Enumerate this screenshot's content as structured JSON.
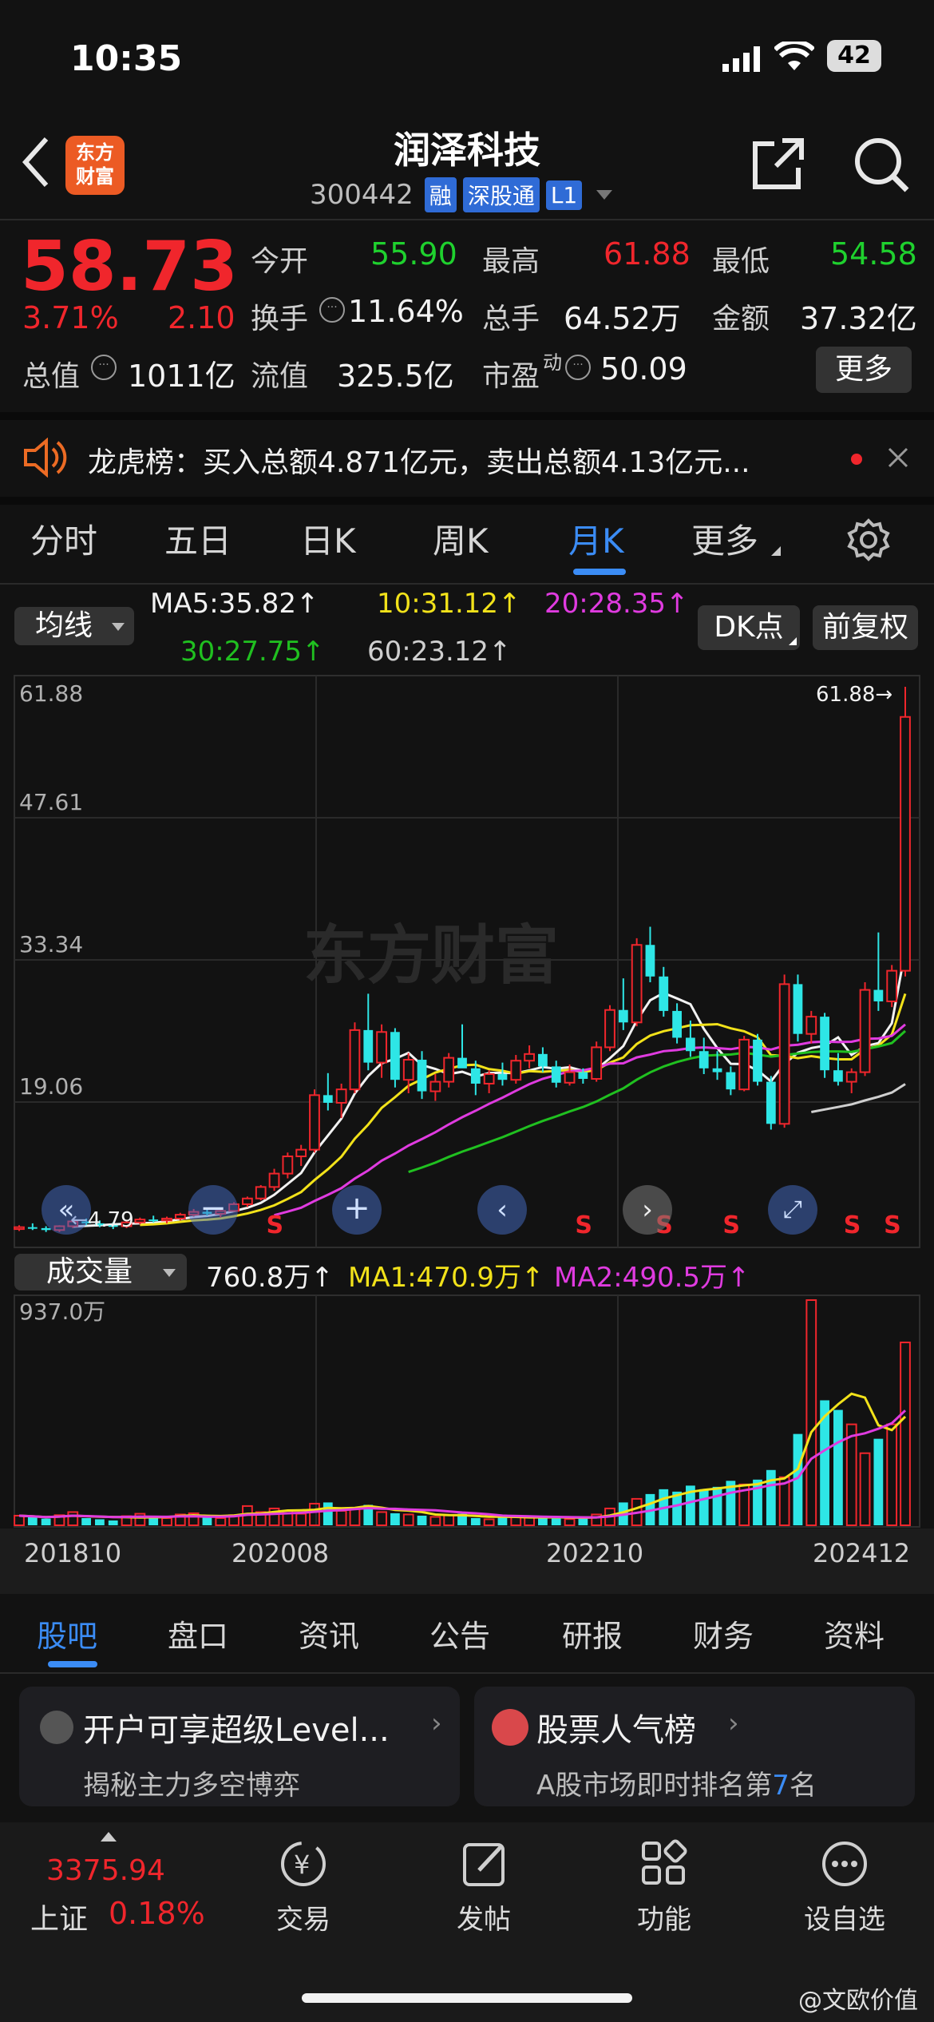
{
  "status": {
    "time": "10:35",
    "battery": "42"
  },
  "header": {
    "title": "润泽科技",
    "code": "300442",
    "badges": [
      "融",
      "深股通",
      "L1"
    ],
    "logo": "东方\n财富"
  },
  "quote": {
    "price": "58.73",
    "pct": "3.71%",
    "chg": "2.10",
    "fields": [
      {
        "label": "今开",
        "value": "55.90",
        "color": "#1fd12e"
      },
      {
        "label": "最高",
        "value": "61.88",
        "color": "#f0262c"
      },
      {
        "label": "最低",
        "value": "54.58",
        "color": "#1fd12e"
      },
      {
        "label": "换手",
        "value": "11.64%",
        "color": "#f2f2f2"
      },
      {
        "label": "总手",
        "value": "64.52万",
        "color": "#f2f2f2"
      },
      {
        "label": "金额",
        "value": "37.32亿",
        "color": "#f2f2f2"
      },
      {
        "label": "总值",
        "value": "1011亿",
        "color": "#f2f2f2"
      },
      {
        "label": "流值",
        "value": "325.5亿",
        "color": "#f2f2f2"
      },
      {
        "label": "市盈",
        "sup": "动",
        "value": "50.09",
        "color": "#f2f2f2"
      }
    ],
    "more": "更多"
  },
  "notice": {
    "text": "龙虎榜：买入总额4.871亿元，卖出总额4.13亿元..."
  },
  "period_tabs": [
    "分时",
    "五日",
    "日K",
    "周K",
    "月K",
    "更多"
  ],
  "active_period": "月K",
  "ma": {
    "selector": "均线",
    "ma5": "MA5:35.82",
    "ma10": "10:31.12",
    "ma20": "20:28.35",
    "ma30": "30:27.75",
    "ma60": "60:23.12",
    "dk": "DK点",
    "adjust": "前复权"
  },
  "chart_data": [
    {
      "type": "candlestick",
      "title": "月K",
      "y_ticks": [
        "61.88",
        "47.61",
        "33.34",
        "19.06"
      ],
      "ylim": [
        4.79,
        61.88
      ],
      "max_label": "61.88",
      "min_label": "4.79",
      "watermark": "东方财富",
      "x_ticks": [
        "201810",
        "202008",
        "202210",
        "202412"
      ],
      "candles": [
        [
          5.2,
          5.6,
          5.0,
          5.4
        ],
        [
          5.4,
          5.8,
          5.1,
          5.3
        ],
        [
          5.3,
          5.5,
          4.9,
          5.1
        ],
        [
          5.1,
          5.6,
          4.9,
          5.5
        ],
        [
          5.5,
          6.2,
          5.3,
          6.0
        ],
        [
          6.0,
          6.3,
          5.6,
          5.8
        ],
        [
          5.8,
          6.1,
          5.4,
          5.6
        ],
        [
          5.6,
          5.9,
          5.2,
          5.5
        ],
        [
          5.5,
          6.0,
          5.3,
          5.9
        ],
        [
          5.9,
          6.4,
          5.7,
          6.2
        ],
        [
          6.2,
          6.6,
          5.9,
          6.1
        ],
        [
          6.1,
          6.5,
          5.8,
          6.3
        ],
        [
          6.3,
          6.9,
          6.1,
          6.7
        ],
        [
          6.7,
          7.3,
          6.5,
          7.0
        ],
        [
          7.0,
          7.4,
          6.6,
          6.8
        ],
        [
          6.8,
          7.2,
          6.4,
          7.1
        ],
        [
          7.1,
          8.0,
          7.0,
          7.8
        ],
        [
          7.8,
          8.6,
          7.5,
          8.4
        ],
        [
          8.4,
          9.8,
          8.2,
          9.6
        ],
        [
          9.6,
          11.5,
          9.2,
          11.0
        ],
        [
          11.0,
          13.2,
          10.5,
          12.8
        ],
        [
          12.8,
          14.0,
          11.8,
          13.5
        ],
        [
          13.5,
          19.8,
          13.2,
          19.2
        ],
        [
          19.2,
          21.5,
          17.6,
          18.4
        ],
        [
          18.4,
          20.4,
          16.8,
          19.8
        ],
        [
          19.8,
          26.8,
          19.4,
          26.0
        ],
        [
          26.0,
          29.8,
          21.8,
          22.6
        ],
        [
          22.6,
          26.6,
          21.0,
          25.8
        ],
        [
          25.8,
          26.2,
          20.0,
          20.8
        ],
        [
          20.8,
          23.6,
          19.4,
          22.9
        ],
        [
          22.9,
          23.8,
          18.8,
          19.6
        ],
        [
          19.6,
          21.4,
          18.6,
          20.6
        ],
        [
          20.6,
          23.6,
          20.0,
          23.1
        ],
        [
          23.1,
          26.6,
          22.4,
          22.0
        ],
        [
          22.0,
          22.8,
          19.2,
          20.4
        ],
        [
          20.4,
          21.8,
          19.4,
          21.4
        ],
        [
          21.4,
          22.6,
          20.2,
          20.8
        ],
        [
          20.8,
          23.4,
          20.4,
          22.8
        ],
        [
          22.8,
          24.4,
          22.0,
          23.5
        ],
        [
          23.5,
          24.2,
          21.6,
          22.2
        ],
        [
          22.2,
          22.8,
          20.0,
          20.5
        ],
        [
          20.5,
          22.4,
          20.2,
          21.6
        ],
        [
          21.6,
          22.0,
          20.4,
          20.9
        ],
        [
          20.9,
          24.8,
          20.6,
          24.2
        ],
        [
          24.2,
          28.6,
          23.8,
          28.1
        ],
        [
          28.1,
          31.4,
          26.0,
          26.8
        ],
        [
          26.8,
          35.6,
          26.4,
          34.9
        ],
        [
          34.9,
          36.8,
          31.0,
          31.6
        ],
        [
          31.6,
          32.6,
          27.4,
          28.0
        ],
        [
          28.0,
          28.8,
          24.6,
          25.2
        ],
        [
          25.2,
          27.0,
          23.2,
          23.8
        ],
        [
          23.8,
          25.2,
          21.4,
          22.0
        ],
        [
          22.0,
          23.8,
          20.8,
          21.6
        ],
        [
          21.6,
          22.2,
          19.2,
          19.8
        ],
        [
          19.8,
          25.4,
          19.6,
          25.0
        ],
        [
          25.0,
          25.6,
          20.2,
          20.6
        ],
        [
          20.6,
          21.2,
          15.6,
          16.2
        ],
        [
          16.2,
          31.8,
          15.8,
          30.8
        ],
        [
          30.8,
          31.8,
          24.8,
          25.6
        ],
        [
          25.6,
          28.0,
          24.6,
          27.4
        ],
        [
          27.4,
          27.8,
          21.0,
          21.8
        ],
        [
          21.8,
          23.6,
          20.2,
          20.6
        ],
        [
          20.6,
          22.0,
          19.4,
          21.6
        ],
        [
          21.6,
          31.0,
          21.2,
          30.2
        ],
        [
          30.2,
          36.2,
          28.0,
          29.0
        ],
        [
          29.0,
          32.8,
          28.4,
          32.2
        ],
        [
          32.2,
          61.88,
          31.6,
          58.73
        ]
      ],
      "ma_lines": {
        "MA5": {
          "color": "#f2f2f2"
        },
        "MA10": {
          "color": "#f2e21a"
        },
        "MA20": {
          "color": "#e03be0"
        },
        "MA30": {
          "color": "#20c020"
        },
        "MA60": {
          "color": "#cfcfcf"
        }
      },
      "sell_markers": [
        "S",
        "S",
        "S",
        "S",
        "S",
        "S"
      ]
    },
    {
      "type": "bar",
      "title": "成交量",
      "ymax_label": "937.0万",
      "series": [
        {
          "name": "成交量",
          "value_label": "760.8万"
        },
        {
          "name": "MA1",
          "value_label": "MA1:470.9万"
        },
        {
          "name": "MA2",
          "value_label": "MA2:490.5万"
        }
      ],
      "values": [
        40,
        35,
        28,
        42,
        55,
        30,
        25,
        20,
        38,
        48,
        35,
        30,
        45,
        50,
        38,
        30,
        42,
        80,
        55,
        70,
        60,
        48,
        90,
        95,
        60,
        70,
        85,
        55,
        50,
        45,
        40,
        35,
        42,
        48,
        30,
        25,
        32,
        40,
        38,
        30,
        28,
        26,
        35,
        45,
        70,
        95,
        110,
        130,
        150,
        140,
        165,
        150,
        160,
        185,
        170,
        190,
        230,
        200,
        380,
        937,
        520,
        480,
        420,
        300,
        360,
        420,
        760.8
      ]
    }
  ],
  "vol_selector": "成交量",
  "sub_tabs": [
    "股吧",
    "盘口",
    "资讯",
    "公告",
    "研报",
    "财务",
    "资料"
  ],
  "active_sub_tab": "股吧",
  "cards": [
    {
      "title": "开户可享超级Level...",
      "desc": "揭秘主力多空博弈"
    },
    {
      "title": "股票人气榜",
      "desc_pre": "A股市场即时排名第",
      "rank": "7",
      "desc_post": "名"
    }
  ],
  "bottom": {
    "index_value": "3375.94",
    "index_name": "上证",
    "index_pct": "0.18%",
    "nav": [
      "交易",
      "发帖",
      "功能",
      "设自选"
    ]
  },
  "watermark_weibo": "@文欧价值"
}
